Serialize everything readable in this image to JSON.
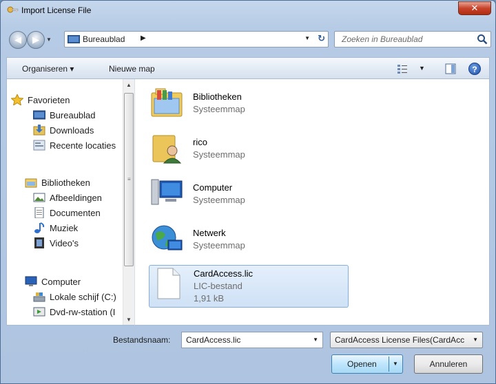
{
  "window": {
    "title": "Import License File"
  },
  "address": {
    "path_label": "Bureaublad",
    "separator": "▶",
    "search_placeholder": "Zoeken in Bureaublad"
  },
  "toolbar": {
    "organise_label": "Organiseren ▾",
    "new_folder_label": "Nieuwe map"
  },
  "sidebar": {
    "items": [
      {
        "label": "Favorieten",
        "icon": "star-icon"
      },
      {
        "label": "Bureaublad",
        "icon": "desktop-icon"
      },
      {
        "label": "Downloads",
        "icon": "downloads-icon"
      },
      {
        "label": "Recente locaties",
        "icon": "recent-places-icon"
      },
      {
        "label": "Bibliotheken",
        "icon": "libraries-icon"
      },
      {
        "label": "Afbeeldingen",
        "icon": "pictures-icon"
      },
      {
        "label": "Documenten",
        "icon": "documents-icon"
      },
      {
        "label": "Muziek",
        "icon": "music-icon"
      },
      {
        "label": "Video's",
        "icon": "videos-icon"
      },
      {
        "label": "Computer",
        "icon": "computer-icon"
      },
      {
        "label": "Lokale schijf (C:)",
        "icon": "local-disk-icon"
      },
      {
        "label": "Dvd-rw-station (I",
        "icon": "dvd-drive-icon"
      }
    ]
  },
  "files": [
    {
      "name": "Bibliotheken",
      "type": "Systeemmap",
      "icon": "libraries-folder-icon"
    },
    {
      "name": "rico",
      "type": "Systeemmap",
      "icon": "user-folder-icon"
    },
    {
      "name": "Computer",
      "type": "Systeemmap",
      "icon": "computer-icon"
    },
    {
      "name": "Netwerk",
      "type": "Systeemmap",
      "icon": "network-icon"
    },
    {
      "name": "CardAccess.lic",
      "type": "LIC-bestand",
      "size": "1,91 kB",
      "icon": "file-icon",
      "selected": true
    }
  ],
  "footer": {
    "filename_label": "Bestandsnaam:",
    "filename_value": "CardAccess.lic",
    "filter_value": "CardAccess License Files(CardAccess.lic)",
    "open_label": "Openen",
    "cancel_label": "Annuleren"
  },
  "colors": {
    "selection": "#cfe1f6",
    "window_frame": "#aec4e0",
    "close_button": "#c7442b"
  }
}
